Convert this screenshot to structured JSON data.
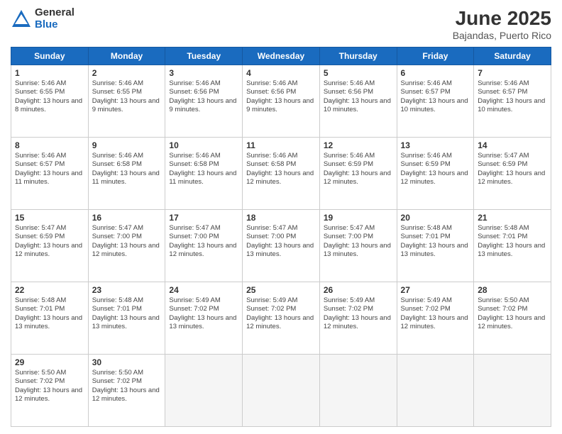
{
  "header": {
    "logo_general": "General",
    "logo_blue": "Blue",
    "title": "June 2025",
    "subtitle": "Bajandas, Puerto Rico"
  },
  "days_of_week": [
    "Sunday",
    "Monday",
    "Tuesday",
    "Wednesday",
    "Thursday",
    "Friday",
    "Saturday"
  ],
  "weeks": [
    [
      {
        "day": "1",
        "sunrise": "5:46 AM",
        "sunset": "6:55 PM",
        "daylight": "13 hours and 8 minutes."
      },
      {
        "day": "2",
        "sunrise": "5:46 AM",
        "sunset": "6:55 PM",
        "daylight": "13 hours and 9 minutes."
      },
      {
        "day": "3",
        "sunrise": "5:46 AM",
        "sunset": "6:56 PM",
        "daylight": "13 hours and 9 minutes."
      },
      {
        "day": "4",
        "sunrise": "5:46 AM",
        "sunset": "6:56 PM",
        "daylight": "13 hours and 9 minutes."
      },
      {
        "day": "5",
        "sunrise": "5:46 AM",
        "sunset": "6:56 PM",
        "daylight": "13 hours and 10 minutes."
      },
      {
        "day": "6",
        "sunrise": "5:46 AM",
        "sunset": "6:57 PM",
        "daylight": "13 hours and 10 minutes."
      },
      {
        "day": "7",
        "sunrise": "5:46 AM",
        "sunset": "6:57 PM",
        "daylight": "13 hours and 10 minutes."
      }
    ],
    [
      {
        "day": "8",
        "sunrise": "5:46 AM",
        "sunset": "6:57 PM",
        "daylight": "13 hours and 11 minutes."
      },
      {
        "day": "9",
        "sunrise": "5:46 AM",
        "sunset": "6:58 PM",
        "daylight": "13 hours and 11 minutes."
      },
      {
        "day": "10",
        "sunrise": "5:46 AM",
        "sunset": "6:58 PM",
        "daylight": "13 hours and 11 minutes."
      },
      {
        "day": "11",
        "sunrise": "5:46 AM",
        "sunset": "6:58 PM",
        "daylight": "13 hours and 12 minutes."
      },
      {
        "day": "12",
        "sunrise": "5:46 AM",
        "sunset": "6:59 PM",
        "daylight": "13 hours and 12 minutes."
      },
      {
        "day": "13",
        "sunrise": "5:46 AM",
        "sunset": "6:59 PM",
        "daylight": "13 hours and 12 minutes."
      },
      {
        "day": "14",
        "sunrise": "5:47 AM",
        "sunset": "6:59 PM",
        "daylight": "13 hours and 12 minutes."
      }
    ],
    [
      {
        "day": "15",
        "sunrise": "5:47 AM",
        "sunset": "6:59 PM",
        "daylight": "13 hours and 12 minutes."
      },
      {
        "day": "16",
        "sunrise": "5:47 AM",
        "sunset": "7:00 PM",
        "daylight": "13 hours and 12 minutes."
      },
      {
        "day": "17",
        "sunrise": "5:47 AM",
        "sunset": "7:00 PM",
        "daylight": "13 hours and 12 minutes."
      },
      {
        "day": "18",
        "sunrise": "5:47 AM",
        "sunset": "7:00 PM",
        "daylight": "13 hours and 13 minutes."
      },
      {
        "day": "19",
        "sunrise": "5:47 AM",
        "sunset": "7:00 PM",
        "daylight": "13 hours and 13 minutes."
      },
      {
        "day": "20",
        "sunrise": "5:48 AM",
        "sunset": "7:01 PM",
        "daylight": "13 hours and 13 minutes."
      },
      {
        "day": "21",
        "sunrise": "5:48 AM",
        "sunset": "7:01 PM",
        "daylight": "13 hours and 13 minutes."
      }
    ],
    [
      {
        "day": "22",
        "sunrise": "5:48 AM",
        "sunset": "7:01 PM",
        "daylight": "13 hours and 13 minutes."
      },
      {
        "day": "23",
        "sunrise": "5:48 AM",
        "sunset": "7:01 PM",
        "daylight": "13 hours and 13 minutes."
      },
      {
        "day": "24",
        "sunrise": "5:49 AM",
        "sunset": "7:02 PM",
        "daylight": "13 hours and 13 minutes."
      },
      {
        "day": "25",
        "sunrise": "5:49 AM",
        "sunset": "7:02 PM",
        "daylight": "13 hours and 12 minutes."
      },
      {
        "day": "26",
        "sunrise": "5:49 AM",
        "sunset": "7:02 PM",
        "daylight": "13 hours and 12 minutes."
      },
      {
        "day": "27",
        "sunrise": "5:49 AM",
        "sunset": "7:02 PM",
        "daylight": "13 hours and 12 minutes."
      },
      {
        "day": "28",
        "sunrise": "5:50 AM",
        "sunset": "7:02 PM",
        "daylight": "13 hours and 12 minutes."
      }
    ],
    [
      {
        "day": "29",
        "sunrise": "5:50 AM",
        "sunset": "7:02 PM",
        "daylight": "13 hours and 12 minutes."
      },
      {
        "day": "30",
        "sunrise": "5:50 AM",
        "sunset": "7:02 PM",
        "daylight": "13 hours and 12 minutes."
      },
      null,
      null,
      null,
      null,
      null
    ]
  ],
  "labels": {
    "sunrise": "Sunrise:",
    "sunset": "Sunset:",
    "daylight": "Daylight:"
  }
}
